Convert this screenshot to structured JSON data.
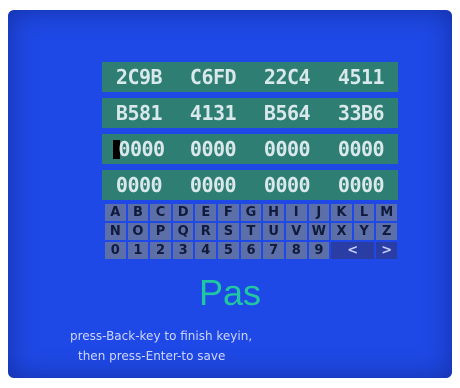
{
  "code_rows": [
    [
      "2C9B",
      "C6FD",
      "22C4",
      "4511"
    ],
    [
      "B581",
      "4131",
      "B564",
      "33B6"
    ],
    [
      "0000",
      "0000",
      "0000",
      "0000"
    ],
    [
      "0000",
      "0000",
      "0000",
      "0000"
    ]
  ],
  "keyboard_rows": [
    [
      "A",
      "B",
      "C",
      "D",
      "E",
      "F",
      "G",
      "H",
      "I",
      "J",
      "K",
      "L",
      "M"
    ],
    [
      "N",
      "O",
      "P",
      "Q",
      "R",
      "S",
      "T",
      "U",
      "V",
      "W",
      "X",
      "Y",
      "Z"
    ],
    [
      "0",
      "1",
      "2",
      "3",
      "4",
      "5",
      "6",
      "7",
      "8",
      "9",
      "<",
      ">"
    ]
  ],
  "title": "Pas",
  "instructions": [
    "press-Back-key to finish keyin,",
    "then press-Enter-to save"
  ],
  "colors": {
    "screen": "#1f49e6",
    "code_row": "#2f7e74",
    "key": "#5d6fa8",
    "title": "#21c7a2"
  }
}
